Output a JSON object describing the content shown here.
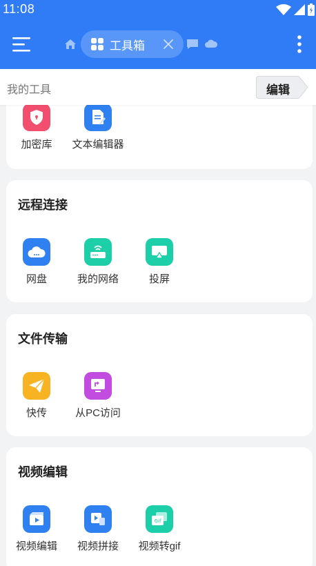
{
  "status_bar": {
    "time": "11:08"
  },
  "app_bar": {
    "active_tab_label": "工具箱",
    "colors": {
      "primary": "#2f7cf6"
    }
  },
  "my_tools": {
    "title": "我的工具",
    "edit_label": "编辑"
  },
  "sections": [
    {
      "title": "",
      "tools": [
        {
          "label": "加密库",
          "icon": "shield-lock-icon",
          "color": "#f24f6e"
        },
        {
          "label": "文本编辑器",
          "icon": "document-edit-icon",
          "color": "#2f80f0"
        }
      ]
    },
    {
      "title": "远程连接",
      "tools": [
        {
          "label": "网盘",
          "icon": "cloud-icon",
          "color": "#2f80f0"
        },
        {
          "label": "我的网络",
          "icon": "router-icon",
          "color": "#1ccfa8"
        },
        {
          "label": "投屏",
          "icon": "screen-cast-icon",
          "color": "#1ccfa8"
        }
      ]
    },
    {
      "title": "文件传输",
      "tools": [
        {
          "label": "快传",
          "icon": "paper-plane-icon",
          "color": "#f7b321"
        },
        {
          "label": "从PC访问",
          "icon": "pc-access-icon",
          "color": "#c24be0"
        }
      ]
    },
    {
      "title": "视频编辑",
      "tools": [
        {
          "label": "视频编辑",
          "icon": "video-edit-icon",
          "color": "#2f80f0"
        },
        {
          "label": "视频拼接",
          "icon": "video-merge-icon",
          "color": "#2f80f0"
        },
        {
          "label": "视频转gif",
          "icon": "gif-convert-icon",
          "color": "#1ccfa8"
        }
      ]
    }
  ]
}
